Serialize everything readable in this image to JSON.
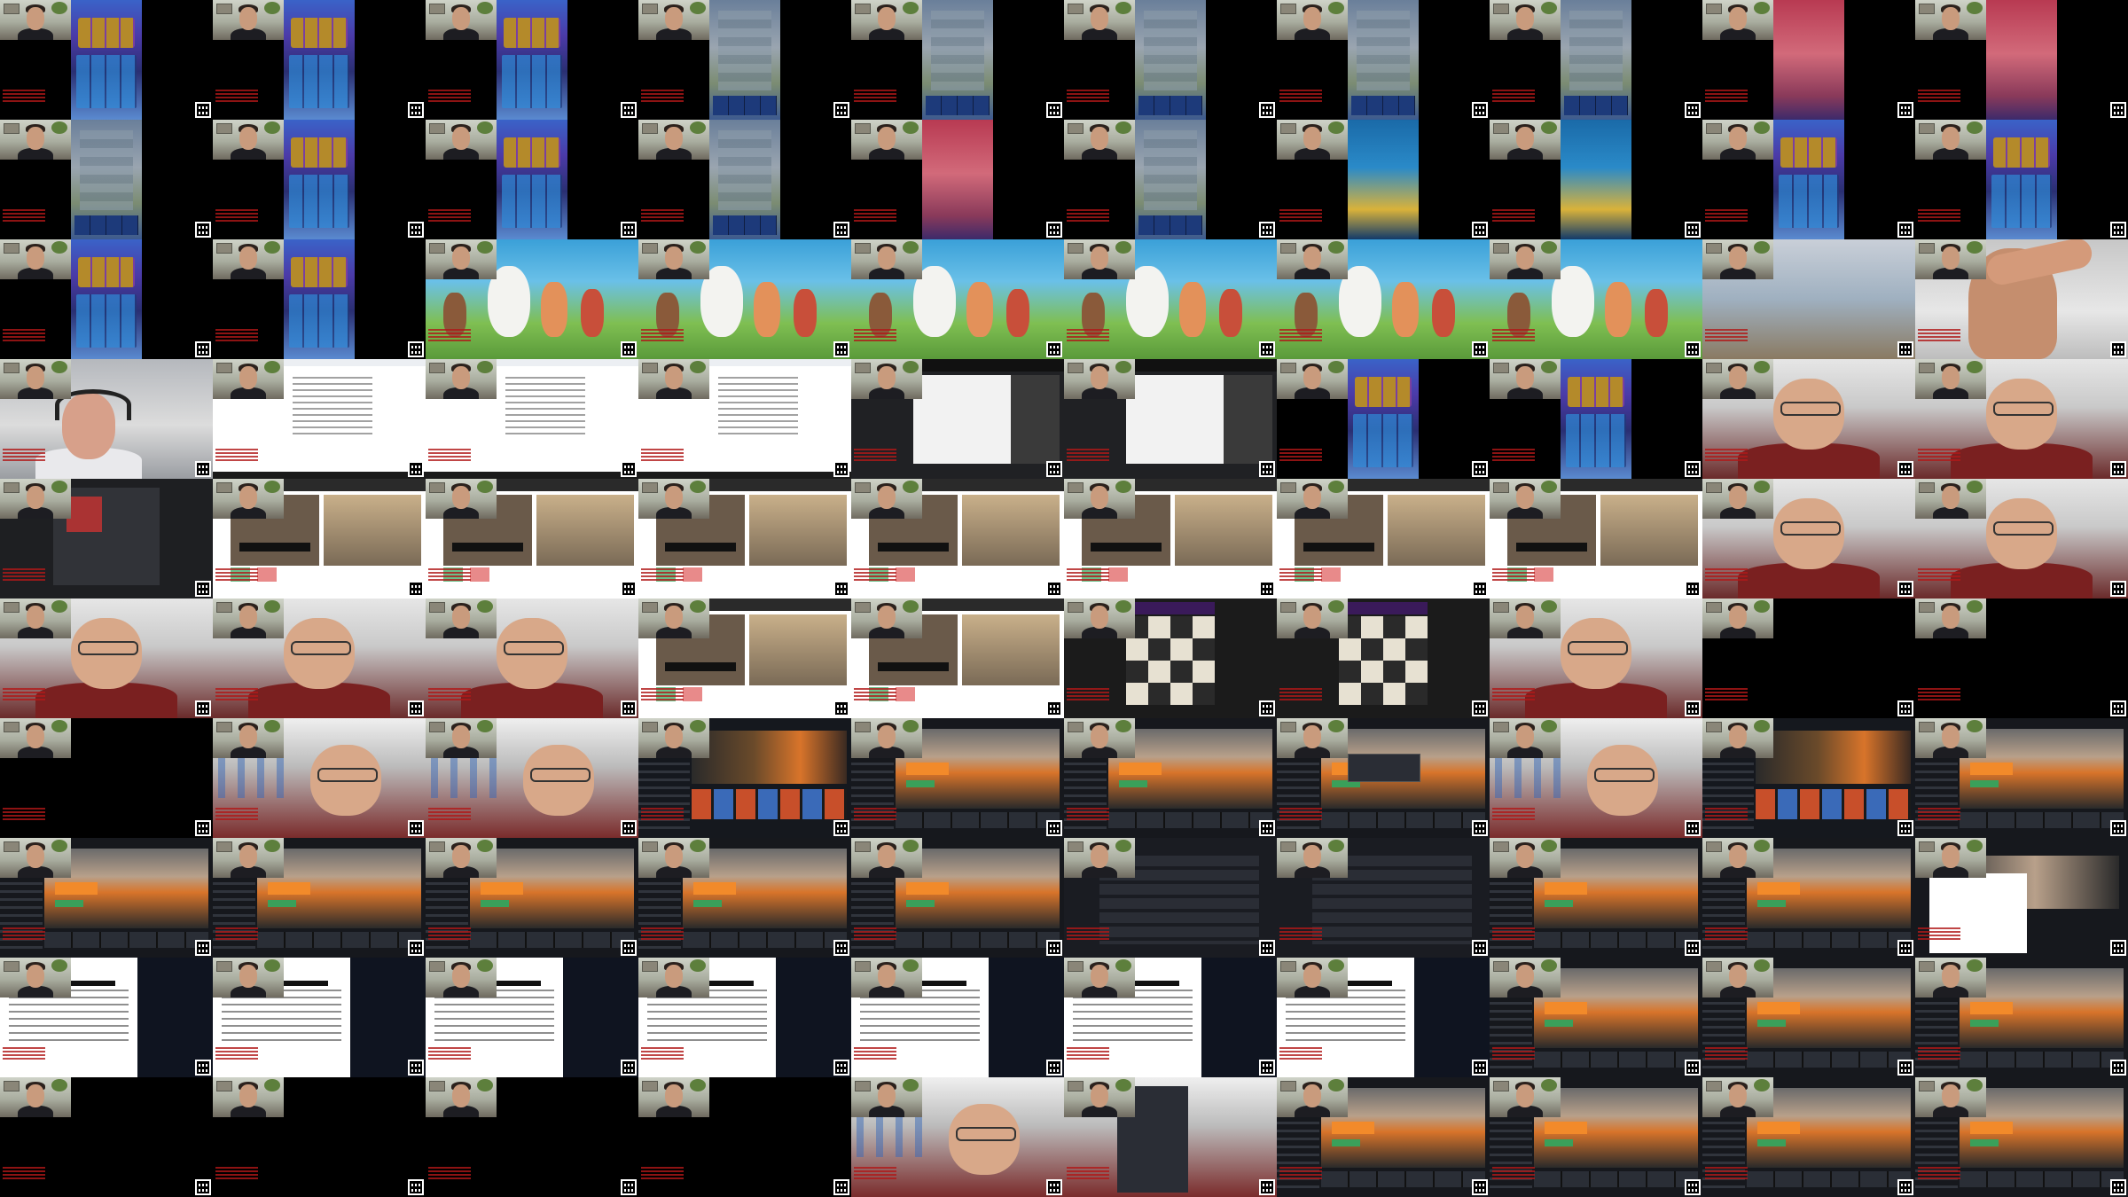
{
  "collage": {
    "columns": 10,
    "rows": 10,
    "tiles": [
      [
        "game",
        "game",
        "game",
        "arena",
        "arena",
        "arena",
        "arena",
        "arena",
        "redarena",
        "redarena"
      ],
      [
        "arena",
        "game",
        "game",
        "arena",
        "redarena",
        "arena",
        "bluearena",
        "bluearena",
        "game",
        "game"
      ],
      [
        "game",
        "game",
        "cartoon",
        "cartoon",
        "cartoon",
        "cartoon",
        "cartoon",
        "cartoon",
        "classroom",
        "closeup"
      ],
      [
        "office",
        "web",
        "web",
        "web",
        "darkweb",
        "darkweb",
        "game",
        "game",
        "redshirt",
        "redshirt"
      ],
      [
        "discord",
        "videochat",
        "videochat",
        "videochat",
        "videochat",
        "videochat",
        "videochat",
        "videochat",
        "redshirt",
        "redshirt"
      ],
      [
        "redshirt",
        "redshirt",
        "redshirt",
        "videochat",
        "videochat",
        "chess",
        "chess",
        "redshirt",
        "black",
        "black"
      ],
      [
        "black",
        "deskphoto",
        "deskphoto",
        "codstore",
        "season",
        "season",
        "dialog",
        "deskphoto",
        "codstore",
        "season"
      ],
      [
        "season",
        "season",
        "season",
        "season",
        "season",
        "settings",
        "settings",
        "season",
        "season",
        "newsletter"
      ],
      [
        "article",
        "article",
        "article",
        "article",
        "article",
        "article",
        "article",
        "season",
        "season",
        "season"
      ],
      [
        "black",
        "black",
        "black",
        "black",
        "deskphoto",
        "startmenu",
        "season",
        "season",
        "season",
        "season"
      ]
    ]
  },
  "colors": {
    "background": "#000000",
    "watermark_red": "#b01818"
  }
}
